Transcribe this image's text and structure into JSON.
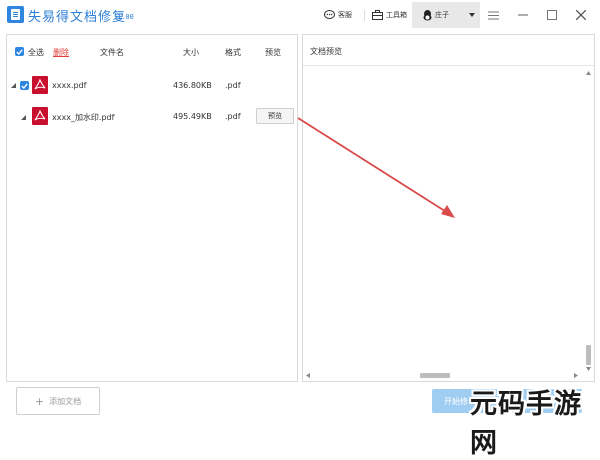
{
  "window": {
    "title": "失易得文档修复",
    "version": "1.00",
    "toolbar": {
      "service_label": "客服",
      "toolbox_label": "工具箱",
      "user_label": "庄子"
    }
  },
  "file_list": {
    "select_all_label": "全选",
    "delete_label": "删除",
    "columns": {
      "name": "文件名",
      "size": "大小",
      "format": "格式",
      "preview": "预览"
    },
    "rows": [
      {
        "name": "xxxx.pdf",
        "size": "436.80KB",
        "format": ".pdf",
        "checked": true
      },
      {
        "name": "xxxx_加水印.pdf",
        "size": "495.49KB",
        "format": ".pdf",
        "preview_label": "预览"
      }
    ]
  },
  "preview_panel": {
    "title": "文档预览"
  },
  "bottom": {
    "add_doc_label": "添加文档",
    "start_label": "开始修"
  },
  "watermark": {
    "text": "元码手游网"
  },
  "colors": {
    "accent": "#2e86de",
    "title": "#2c7fd6",
    "delete": "#e0403a",
    "pdf": "#c8102e",
    "arrow": "#d94a4a",
    "start_button": "#9fcdf2"
  }
}
